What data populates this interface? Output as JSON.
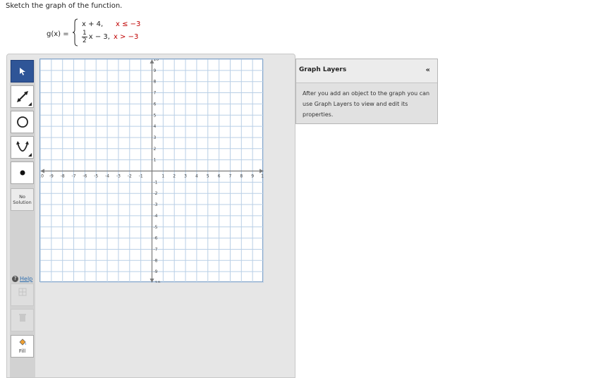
{
  "prompt": "Sketch the graph of the function.",
  "function": {
    "lhs": "g(x) =",
    "case1_expr": "x + 4,",
    "case1_cond": "x ≤ −3",
    "case2_num": "1",
    "case2_den": "2",
    "case2_expr": "x − 3,",
    "case2_cond": "x > −3"
  },
  "toolbar": {
    "no_solution_line1": "No",
    "no_solution_line2": "Solution",
    "help_label": "Help",
    "fill_label": "Fill"
  },
  "graph": {
    "x_min": -10,
    "x_max": 10,
    "y_min": -10,
    "y_max": 10,
    "x_tick_labels": [
      "-10",
      "-9",
      "-8",
      "-7",
      "-6",
      "-5",
      "-4",
      "-3",
      "-2",
      "-1",
      "1",
      "2",
      "3",
      "4",
      "5",
      "6",
      "7",
      "8",
      "9",
      "10"
    ],
    "y_tick_labels": [
      "10",
      "9",
      "8",
      "7",
      "6",
      "5",
      "4",
      "3",
      "2",
      "1",
      "-1",
      "-2",
      "-3",
      "-4",
      "-5",
      "-6",
      "-7",
      "-8",
      "-9",
      "-10"
    ],
    "grid_color": "#b9cfe6",
    "axis_color": "#7b7b7b"
  },
  "layers": {
    "title": "Graph Layers",
    "collapse_symbol": "«",
    "description": "After you add an object to the graph you can use Graph Layers to view and edit its properties."
  },
  "colors": {
    "active_tool": "#2f5597",
    "condition_text": "#c00000"
  }
}
